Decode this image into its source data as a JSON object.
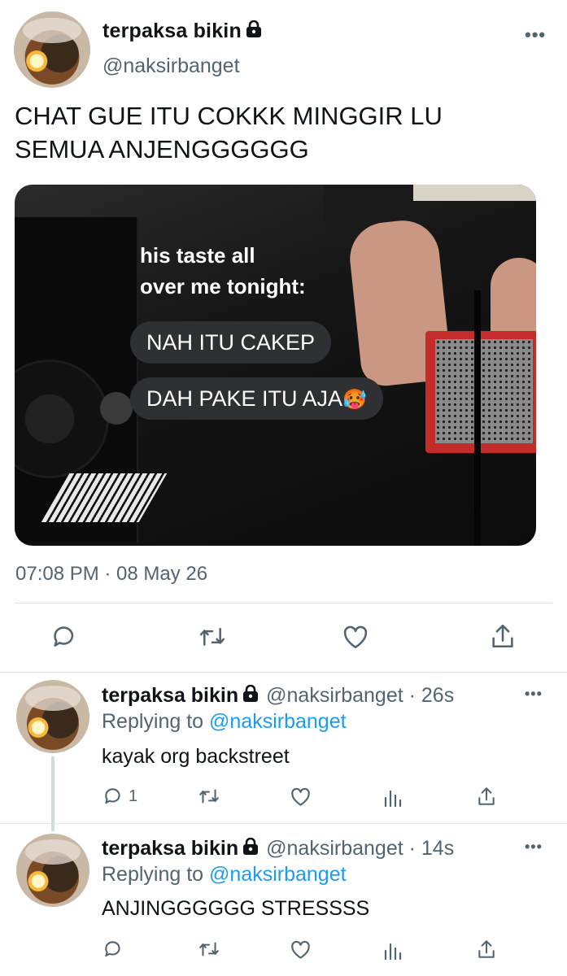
{
  "main_tweet": {
    "display_name": "terpaksa bikin",
    "handle": "@naksirbanget",
    "text_line1": "CHAT GUE ITU COKKK MINGGIR LU",
    "text_line2": "SEMUA ANJENGGGGGG",
    "timestamp": "07:08 PM · 08 May 26",
    "media": {
      "caption_line1": "his taste all",
      "caption_line2": "over me tonight:",
      "bubble1": "NAH ITU CAKEP",
      "bubble2": "DAH PAKE ITU AJA",
      "emoji": "🥵"
    },
    "actions": [
      "reply-icon",
      "retweet-icon",
      "like-icon",
      "share-icon"
    ]
  },
  "replies": [
    {
      "display_name": "terpaksa bikin",
      "handle_time": "@naksirbanget · 26s",
      "replying_prefix": "Replying to",
      "replying_handle": "@naksirbanget",
      "text": "kayak org backstreet",
      "reply_count": "1"
    },
    {
      "display_name": "terpaksa bikin",
      "handle_time": "@naksirbanget · 14s",
      "replying_prefix": "Replying to",
      "replying_handle": "@naksirbanget",
      "text": "ANJINGGGGGG STRESSSS",
      "reply_count": ""
    }
  ],
  "colors": {
    "link": "#1d9bf0",
    "muted": "#536471",
    "text": "#0f1419"
  }
}
